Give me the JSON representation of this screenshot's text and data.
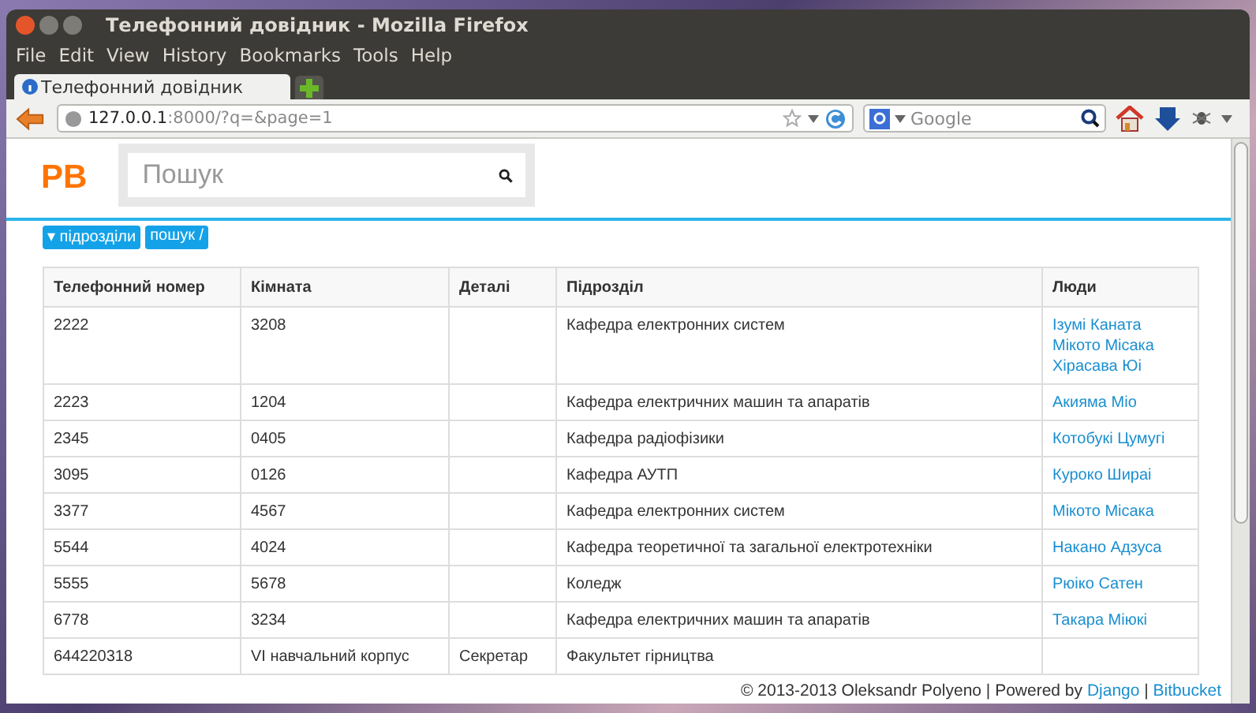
{
  "window": {
    "title": "Телефонний довідник - Mozilla Firefox"
  },
  "menu": [
    "File",
    "Edit",
    "View",
    "History",
    "Bookmarks",
    "Tools",
    "Help"
  ],
  "tabs": [
    {
      "label": "Телефонний довідник",
      "selected": true
    }
  ],
  "address_bar": {
    "host": "127.0.0.1",
    "path": ":8000/?q=&page=1"
  },
  "search_bar": {
    "placeholder": "Google"
  },
  "page": {
    "logo": "PB",
    "search": {
      "placeholder": "Пошук"
    },
    "breadcrumbs": [
      "▾ підрозділи",
      "пошук /"
    ],
    "table": {
      "columns": [
        "Телефонний номер",
        "Кімната",
        "Деталі",
        "Підрозділ",
        "Люди"
      ],
      "rows": [
        {
          "phone": "2222",
          "room": "3208",
          "details": "",
          "department": "Кафедра електронних систем",
          "people": [
            "Ізумі Каната",
            "Мікото Місака",
            "Хірасава Юі"
          ]
        },
        {
          "phone": "2223",
          "room": "1204",
          "details": "",
          "department": "Кафедра електричних машин та апаратів",
          "people": [
            "Акияма Міо"
          ]
        },
        {
          "phone": "2345",
          "room": "0405",
          "details": "",
          "department": "Кафедра радіофізики",
          "people": [
            "Котобукі Цумугі"
          ]
        },
        {
          "phone": "3095",
          "room": "0126",
          "details": "",
          "department": "Кафедра АУТП",
          "people": [
            "Куроко Шираі"
          ]
        },
        {
          "phone": "3377",
          "room": "4567",
          "details": "",
          "department": "Кафедра електронних систем",
          "people": [
            "Мікото Місака"
          ]
        },
        {
          "phone": "5544",
          "room": "4024",
          "details": "",
          "department": "Кафедра теоретичної та загальної електротехніки",
          "people": [
            "Накано Адзуса"
          ]
        },
        {
          "phone": "5555",
          "room": "5678",
          "details": "",
          "department": "Коледж",
          "people": [
            "Рюіко Сатен"
          ]
        },
        {
          "phone": "6778",
          "room": "3234",
          "details": "",
          "department": "Кафедра електричних машин та апаратів",
          "people": [
            "Такара Міюкі"
          ]
        },
        {
          "phone": "644220318",
          "room": "VI навчальний корпус",
          "details": "Секретар",
          "department": "Факультет гірництва",
          "people": []
        }
      ]
    },
    "footer": [
      {
        "kind": "text",
        "text": "© 2013-2013 Oleksandr Polyeno | Powered by"
      },
      {
        "kind": "link",
        "text": "Django"
      },
      {
        "kind": "text",
        "text": "|"
      },
      {
        "kind": "link",
        "text": "Bitbucket"
      }
    ]
  }
}
